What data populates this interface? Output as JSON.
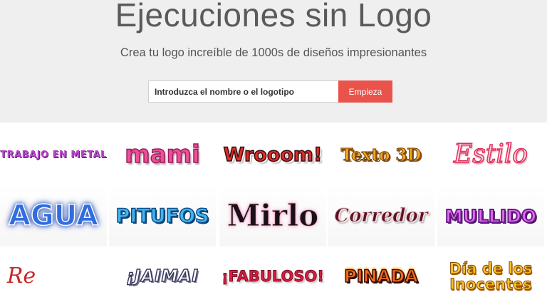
{
  "hero": {
    "title": "Ejecuciones sin Logo",
    "subtitle": "Crea tu logo increíble de 1000s de diseños impresionantes",
    "search_placeholder": "Introduzca el nombre o el logotipo",
    "start_label": "Empieza",
    "accent_color": "#e9534b"
  },
  "gallery": {
    "rows": [
      [
        {
          "text": "TRABAJO EN METAL",
          "style": "metal"
        },
        {
          "text": "mami",
          "style": "mami"
        },
        {
          "text": "Wrooom!",
          "style": "wrooom"
        },
        {
          "text": "Texto 3D",
          "style": "texto"
        },
        {
          "text": "Estilo",
          "style": "estilo"
        }
      ],
      [
        {
          "text": "AGUA",
          "style": "agua"
        },
        {
          "text": "PITUFOS",
          "style": "pitufos"
        },
        {
          "text": "Mirlo",
          "style": "mirlo"
        },
        {
          "text": "Corredor",
          "style": "corredor"
        },
        {
          "text": "MULLIDO",
          "style": "mullido"
        }
      ],
      [
        {
          "text": "Re",
          "style": "re"
        },
        {
          "text": "¡JAIMAI",
          "style": "jaimai"
        },
        {
          "text": "¡FABULOSO!",
          "style": "fabuloso"
        },
        {
          "text": "PINADA",
          "style": "pinada"
        },
        {
          "text": "Día de los Inocentes",
          "style": "dia"
        }
      ]
    ]
  }
}
